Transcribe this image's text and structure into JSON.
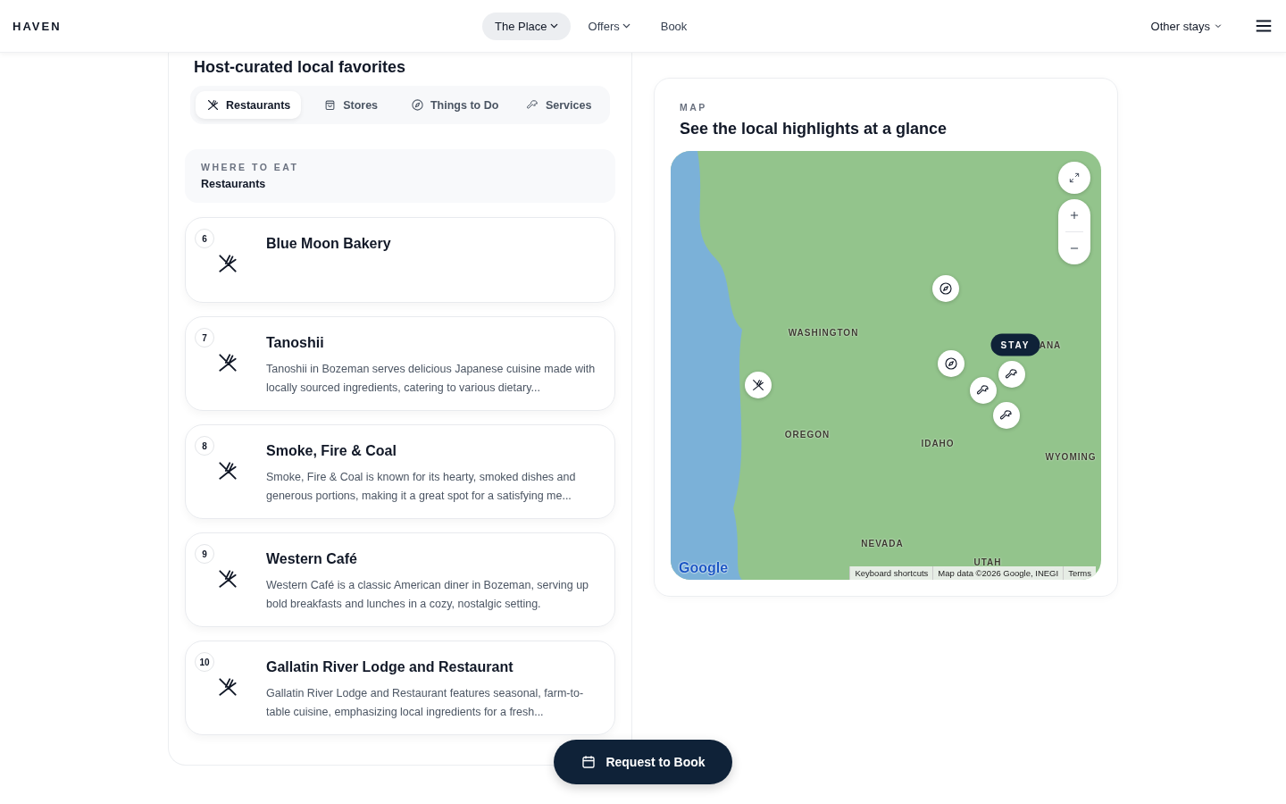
{
  "header": {
    "brand": "HAVEN",
    "nav": [
      {
        "label": "The Place",
        "selected": true,
        "dropdown": true
      },
      {
        "label": "Offers",
        "selected": false,
        "dropdown": true
      },
      {
        "label": "Book",
        "selected": false,
        "dropdown": false
      }
    ],
    "other_stays": "Other stays"
  },
  "favorites": {
    "heading": "Host-curated local favorites",
    "tabs": [
      {
        "label": "Restaurants",
        "kind": "restaurant",
        "selected": true
      },
      {
        "label": "Stores",
        "kind": "bag",
        "selected": false
      },
      {
        "label": "Things to Do",
        "kind": "compass",
        "selected": false
      },
      {
        "label": "Services",
        "kind": "wrench",
        "selected": false
      }
    ],
    "section": {
      "eyebrow": "WHERE TO EAT",
      "title": "Restaurants"
    },
    "places": [
      {
        "number": "6",
        "name": "Blue Moon Bakery"
      },
      {
        "number": "7",
        "name": "Tanoshii",
        "description": "Tanoshii in Bozeman serves delicious Japanese cuisine made with locally sourced ingredients, catering to various dietary..."
      },
      {
        "number": "8",
        "name": "Smoke, Fire & Coal",
        "description": "Smoke, Fire & Coal is known for its hearty, smoked dishes and generous portions, making it a great spot for a satisfying me..."
      },
      {
        "number": "9",
        "name": "Western Café",
        "description": "Western Café is a classic American diner in Bozeman, serving up bold breakfasts and lunches in a cozy, nostalgic setting."
      },
      {
        "number": "10",
        "name": "Gallatin River Lodge and Restaurant",
        "description": "Gallatin River Lodge and Restaurant features seasonal, farm-to-table cuisine, emphasizing local ingredients for a fresh..."
      }
    ]
  },
  "map": {
    "eyebrow": "MAP",
    "title": "See the local highlights at a glance",
    "labels": [
      "WASHINGTON",
      "ANA",
      "OREGON",
      "IDAHO",
      "WYOMING",
      "NEVADA",
      "UTAH"
    ],
    "markers": [
      {
        "kind": "compass"
      },
      {
        "kind": "compass"
      },
      {
        "kind": "restaurant"
      },
      {
        "kind": "wrench"
      },
      {
        "kind": "wrench"
      },
      {
        "kind": "wrench"
      }
    ],
    "stay_label": "STAY",
    "logo": "Google",
    "attribution": [
      "Keyboard shortcuts",
      "Map data ©2026 Google, INEGI",
      "Terms"
    ]
  },
  "book_button": "Request to Book"
}
